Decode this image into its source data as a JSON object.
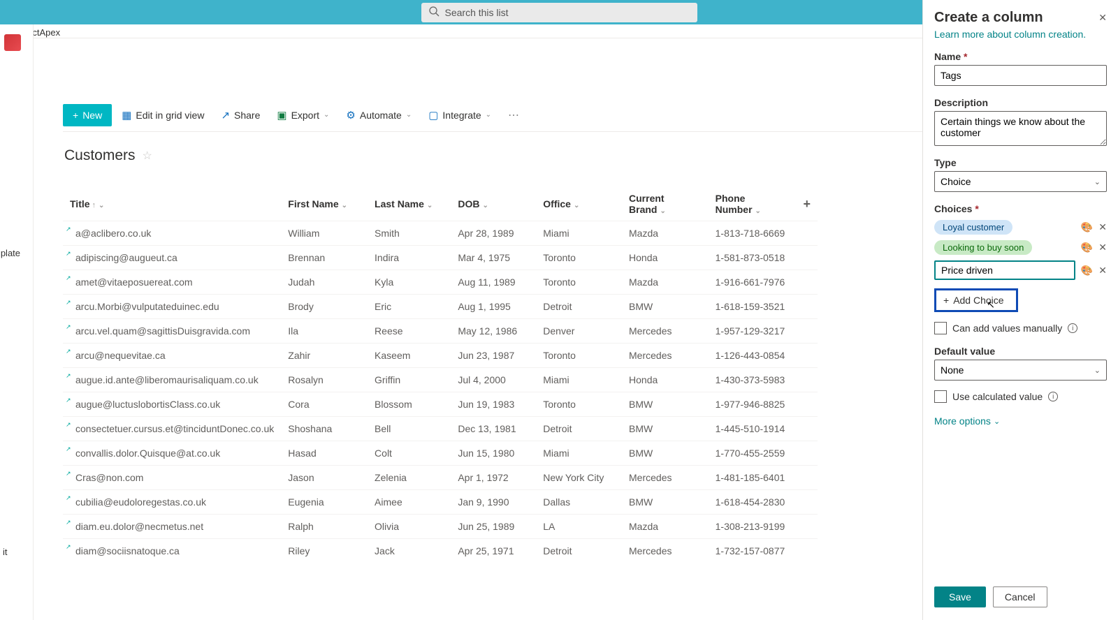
{
  "search": {
    "placeholder": "Search this list"
  },
  "breadcrumb": "ProjectApex",
  "sidebar": {
    "label1": "mplate",
    "label2": "it"
  },
  "toolbar": {
    "new": "New",
    "grid": "Edit in grid view",
    "share": "Share",
    "export": "Export",
    "automate": "Automate",
    "integrate": "Integrate"
  },
  "list": {
    "title": "Customers"
  },
  "columns": [
    "Title",
    "First Name",
    "Last Name",
    "DOB",
    "Office",
    "Current Brand",
    "Phone Number"
  ],
  "rows": [
    {
      "title": "a@aclibero.co.uk",
      "fn": "William",
      "ln": "Smith",
      "dob": "Apr 28, 1989",
      "office": "Miami",
      "brand": "Mazda",
      "phone": "1-813-718-6669"
    },
    {
      "title": "adipiscing@augueut.ca",
      "fn": "Brennan",
      "ln": "Indira",
      "dob": "Mar 4, 1975",
      "office": "Toronto",
      "brand": "Honda",
      "phone": "1-581-873-0518"
    },
    {
      "title": "amet@vitaeposuereat.com",
      "fn": "Judah",
      "ln": "Kyla",
      "dob": "Aug 11, 1989",
      "office": "Toronto",
      "brand": "Mazda",
      "phone": "1-916-661-7976"
    },
    {
      "title": "arcu.Morbi@vulputateduinec.edu",
      "fn": "Brody",
      "ln": "Eric",
      "dob": "Aug 1, 1995",
      "office": "Detroit",
      "brand": "BMW",
      "phone": "1-618-159-3521"
    },
    {
      "title": "arcu.vel.quam@sagittisDuisgravida.com",
      "fn": "Ila",
      "ln": "Reese",
      "dob": "May 12, 1986",
      "office": "Denver",
      "brand": "Mercedes",
      "phone": "1-957-129-3217"
    },
    {
      "title": "arcu@nequevitae.ca",
      "fn": "Zahir",
      "ln": "Kaseem",
      "dob": "Jun 23, 1987",
      "office": "Toronto",
      "brand": "Mercedes",
      "phone": "1-126-443-0854"
    },
    {
      "title": "augue.id.ante@liberomaurisaliquam.co.uk",
      "fn": "Rosalyn",
      "ln": "Griffin",
      "dob": "Jul 4, 2000",
      "office": "Miami",
      "brand": "Honda",
      "phone": "1-430-373-5983"
    },
    {
      "title": "augue@luctuslobortisClass.co.uk",
      "fn": "Cora",
      "ln": "Blossom",
      "dob": "Jun 19, 1983",
      "office": "Toronto",
      "brand": "BMW",
      "phone": "1-977-946-8825"
    },
    {
      "title": "consectetuer.cursus.et@tinciduntDonec.co.uk",
      "fn": "Shoshana",
      "ln": "Bell",
      "dob": "Dec 13, 1981",
      "office": "Detroit",
      "brand": "BMW",
      "phone": "1-445-510-1914"
    },
    {
      "title": "convallis.dolor.Quisque@at.co.uk",
      "fn": "Hasad",
      "ln": "Colt",
      "dob": "Jun 15, 1980",
      "office": "Miami",
      "brand": "BMW",
      "phone": "1-770-455-2559"
    },
    {
      "title": "Cras@non.com",
      "fn": "Jason",
      "ln": "Zelenia",
      "dob": "Apr 1, 1972",
      "office": "New York City",
      "brand": "Mercedes",
      "phone": "1-481-185-6401"
    },
    {
      "title": "cubilia@eudoloregestas.co.uk",
      "fn": "Eugenia",
      "ln": "Aimee",
      "dob": "Jan 9, 1990",
      "office": "Dallas",
      "brand": "BMW",
      "phone": "1-618-454-2830"
    },
    {
      "title": "diam.eu.dolor@necmetus.net",
      "fn": "Ralph",
      "ln": "Olivia",
      "dob": "Jun 25, 1989",
      "office": "LA",
      "brand": "Mazda",
      "phone": "1-308-213-9199"
    },
    {
      "title": "diam@sociisnatoque.ca",
      "fn": "Riley",
      "ln": "Jack",
      "dob": "Apr 25, 1971",
      "office": "Detroit",
      "brand": "Mercedes",
      "phone": "1-732-157-0877"
    }
  ],
  "panel": {
    "title": "Create a column",
    "learn": "Learn more about column creation.",
    "name_label": "Name",
    "name_value": "Tags",
    "desc_label": "Description",
    "desc_value": "Certain things we know about the customer",
    "type_label": "Type",
    "type_value": "Choice",
    "choices_label": "Choices",
    "choice1": "Loyal customer",
    "choice2": "Looking to buy soon",
    "choice3": "Price driven",
    "add_choice": "Add Choice",
    "manual": "Can add values manually",
    "default_label": "Default value",
    "default_value": "None",
    "calc": "Use calculated value",
    "more": "More options",
    "save": "Save",
    "cancel": "Cancel"
  }
}
